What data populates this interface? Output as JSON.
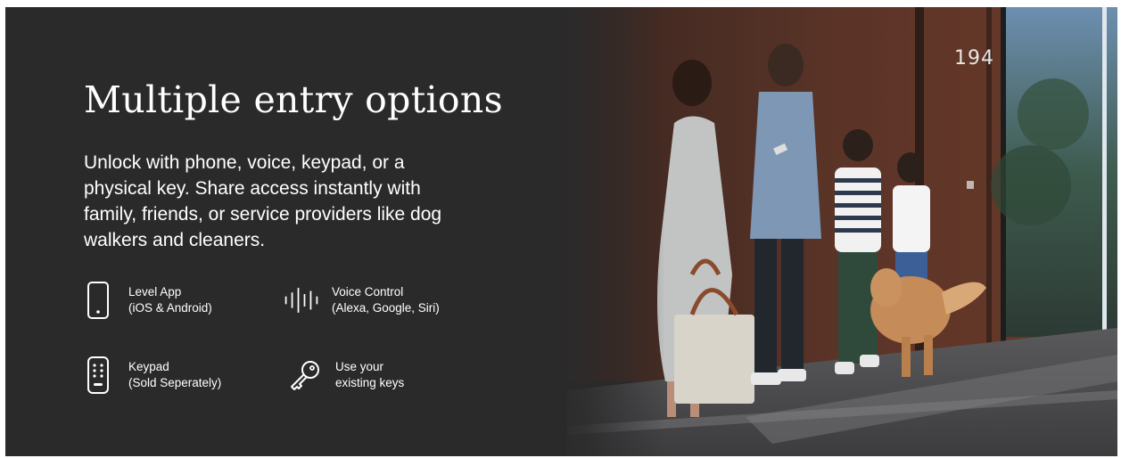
{
  "banner": {
    "headline": "Multiple entry options",
    "description": "Unlock with phone, voice, keypad, or a physical key. Share access instantly with family, friends, or service providers like dog walkers and cleaners."
  },
  "features": [
    {
      "icon": "smartphone-icon",
      "line1": "Level App",
      "line2": "(iOS & Android)"
    },
    {
      "icon": "sound-wave-icon",
      "line1": "Voice Control",
      "line2": "(Alexa, Google, Siri)"
    },
    {
      "icon": "keypad-icon",
      "line1": "Keypad",
      "line2": "(Sold Seperately)"
    },
    {
      "icon": "key-icon",
      "line1": "Use your",
      "line2": "existing keys"
    }
  ],
  "photo": {
    "house_number": "194"
  },
  "colors": {
    "panel_background": "#2b2a2b",
    "text": "#ffffff"
  }
}
